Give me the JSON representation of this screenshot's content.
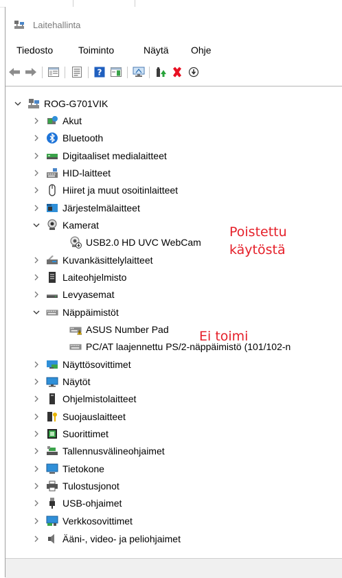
{
  "window": {
    "title": "Laitehallinta"
  },
  "menu": [
    "Tiedosto",
    "Toiminto",
    "Näytä",
    "Ohje"
  ],
  "tree": {
    "root": "ROG-G701VIK",
    "categories": [
      "Akut",
      "Bluetooth",
      "Digitaaliset medialaitteet",
      "HID-laitteet",
      "Hiiret ja muut osoitinlaitteet",
      "Järjestelmälaitteet",
      "Kamerat",
      "Kuvankäsittelylaitteet",
      "Laiteohjelmisto",
      "Levyasemat",
      "Näppäimistöt",
      "Näyttösovittimet",
      "Näytöt",
      "Ohjelmistolaitteet",
      "Suojauslaitteet",
      "Suorittimet",
      "Tallennusvälineohjaimet",
      "Tietokone",
      "Tulostusjonot",
      "USB-ohjaimet",
      "Verkkosovittimet",
      "Ääni-, video- ja peliohjaimet"
    ],
    "camera_device": "USB2.0 HD UVC WebCam",
    "keyboard_devices": [
      "ASUS Number Pad",
      "PC/AT laajennettu PS/2-näppäimistö (101/102-n"
    ]
  },
  "annotations": {
    "disabled_line1": "Poistettu",
    "disabled_line2": "käytöstä",
    "not_working": "Ei toimi"
  },
  "colors": {
    "annotation": "#e5202a",
    "error_x": "#e81123",
    "help_blue": "#1f5fbf"
  }
}
